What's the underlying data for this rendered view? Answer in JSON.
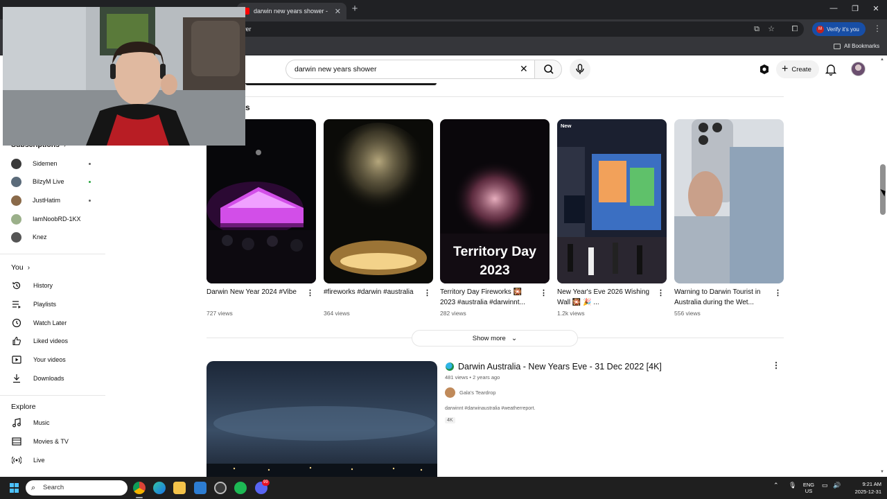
{
  "browser": {
    "tabs": [
      {
        "label": "",
        "state": "inactive",
        "favicon_color": "#ff0000"
      },
      {
        "label": "",
        "state": "inactive",
        "favicon_color": "#1db954"
      },
      {
        "label": "darwin new years shower - You",
        "state": "active",
        "favicon_color": "#ff0000"
      }
    ],
    "address_text": "wer",
    "verify_label": "Verify it's you",
    "verify_avatar_letter": "M",
    "all_bookmarks_label": "All Bookmarks"
  },
  "youtube": {
    "search_query": "darwin new years shower",
    "create_label": "Create",
    "shelf_title": "s",
    "show_more_label": "Show more",
    "shorts": [
      {
        "title": "Darwin New Year 2024 #Vibe",
        "views": "727 views"
      },
      {
        "title": "#fireworks #darwin #australia",
        "views": "364 views"
      },
      {
        "title": "Territory Day Fireworks 🎇 2023 #australia #darwinnt...",
        "views": "282 views",
        "overlay_line1": "Territory Day",
        "overlay_line2": "2023"
      },
      {
        "title": "New Year's Eve 2026 Wishing Wall 🎇 🎉 ...",
        "views": "1.2k views",
        "badge": "New"
      },
      {
        "title": "Warning to Darwin Tourist in Australia during the Wet...",
        "views": "556 views"
      }
    ],
    "video": {
      "title": "Darwin Australia - New Years Eve - 31 Dec 2022 [4K]",
      "meta": "481 views • 2 years ago",
      "channel": "Gala's Teardrop",
      "description": "darwinnt #darwinaustralia #weatherreport.",
      "tag": "4K"
    }
  },
  "sidebar": {
    "subscriptions_title": "Subscriptions",
    "subscriptions": [
      {
        "label": "Sidemen",
        "avatar_color": "#3a3a3a",
        "dot": true
      },
      {
        "label": "BilzyM Live",
        "avatar_color": "#5b6b7a",
        "dot": true
      },
      {
        "label": "JustHatim",
        "avatar_color": "#8a6a4a",
        "dot": true
      },
      {
        "label": "IamNoobRD-1KX",
        "avatar_color": "#9bb08a",
        "dot": false
      },
      {
        "label": "Knez",
        "avatar_color": "#555555",
        "dot": false
      }
    ],
    "you_title": "You",
    "you_items": [
      {
        "label": "History",
        "icon": "history-icon"
      },
      {
        "label": "Playlists",
        "icon": "playlists-icon"
      },
      {
        "label": "Watch Later",
        "icon": "watch-later-icon"
      },
      {
        "label": "Liked videos",
        "icon": "liked-videos-icon"
      },
      {
        "label": "Your videos",
        "icon": "your-videos-icon"
      },
      {
        "label": "Downloads",
        "icon": "downloads-icon"
      }
    ],
    "explore_title": "Explore",
    "explore_items": [
      {
        "label": "Music",
        "icon": "music-icon"
      },
      {
        "label": "Movies & TV",
        "icon": "movies-icon"
      },
      {
        "label": "Live",
        "icon": "live-icon"
      }
    ]
  },
  "taskbar": {
    "search_placeholder": "Search",
    "language_line1": "ENG",
    "language_line2": "US",
    "time": "9:21 AM",
    "date": "2025-12-31",
    "badge_count": "99"
  },
  "colors": {
    "accent_blue": "#065fd4",
    "browser_dark": "#202124",
    "taskbar_bg": "#1f1f1f"
  }
}
